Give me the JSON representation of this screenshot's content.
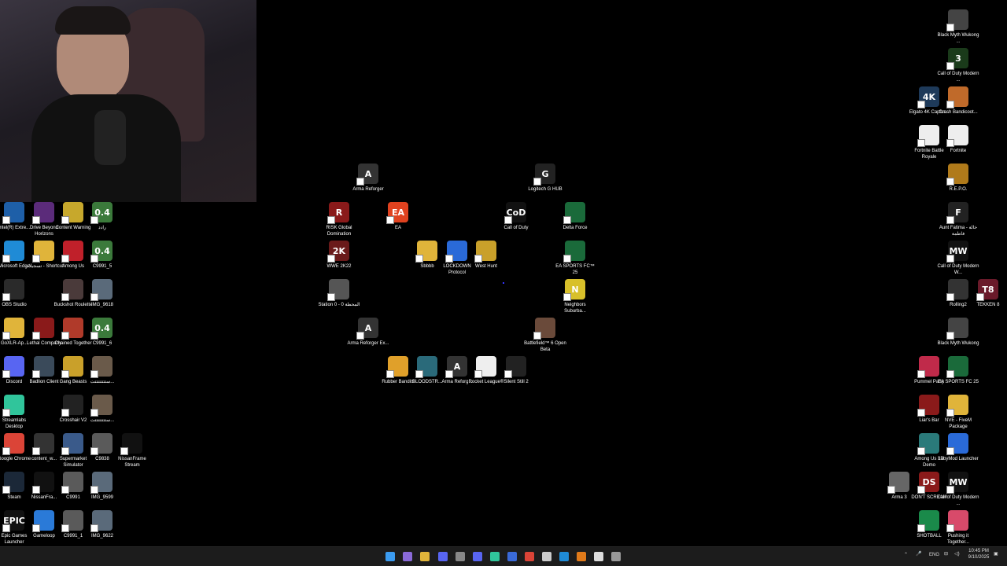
{
  "desktop_icons": [
    {
      "label": "Intel(R) Extre...",
      "color": "#1e5fa8",
      "glyph": ""
    },
    {
      "label": "Drive Beyond Horizons",
      "color": "#5b2b7a",
      "glyph": ""
    },
    {
      "label": "Content Warning",
      "color": "#c7a82c",
      "glyph": ""
    },
    {
      "label": "رادد",
      "color": "#3b7a3b",
      "glyph": "0.4"
    },
    {
      "label": "Microsoft Edge",
      "color": "#1f8bd6",
      "glyph": ""
    },
    {
      "label": "تسجيلات - Shortcut",
      "color": "#e0b43a",
      "glyph": ""
    },
    {
      "label": "Among Us",
      "color": "#c0202a",
      "glyph": ""
    },
    {
      "label": "C9991_5",
      "color": "#3b7a3b",
      "glyph": "0.4"
    },
    {
      "label": "OBS Studio",
      "color": "#2a2a2a",
      "glyph": ""
    },
    {
      "label": "Buckshot Roulette",
      "color": "#4a3a3a",
      "glyph": ""
    },
    {
      "label": "IMG_9618",
      "color": "#5a6a7a",
      "glyph": ""
    },
    {
      "label": "GoXLR-Ap...",
      "color": "#e0b43a",
      "glyph": ""
    },
    {
      "label": "Lethal Company",
      "color": "#8a1a1a",
      "glyph": ""
    },
    {
      "label": "Chained Together",
      "color": "#b03a2a",
      "glyph": ""
    },
    {
      "label": "C9991_6",
      "color": "#3b7a3b",
      "glyph": "0.4"
    },
    {
      "label": "Discord",
      "color": "#5865f2",
      "glyph": ""
    },
    {
      "label": "Badlion Client",
      "color": "#3a4a5a",
      "glyph": ""
    },
    {
      "label": "Gang Beasts",
      "color": "#c9a02a",
      "glyph": ""
    },
    {
      "label": "ستتتتتتتتت...",
      "color": "#6a5a4a",
      "glyph": ""
    },
    {
      "label": "Streamlabs Desktop",
      "color": "#30c59b",
      "glyph": ""
    },
    {
      "label": "Crosshair V2",
      "color": "#222",
      "glyph": ""
    },
    {
      "label": "ستتتتتتتتت...",
      "color": "#6a5a4a",
      "glyph": ""
    },
    {
      "label": "Google Chrome",
      "color": "#db4437",
      "glyph": ""
    },
    {
      "label": "content_w...",
      "color": "#333",
      "glyph": ""
    },
    {
      "label": "Supermarket Simulator",
      "color": "#3a5a8a",
      "glyph": ""
    },
    {
      "label": "C9838",
      "color": "#5a5a5a",
      "glyph": ""
    },
    {
      "label": "NissanFrame Stream",
      "color": "#111",
      "glyph": ""
    },
    {
      "label": "Steam",
      "color": "#1b2838",
      "glyph": ""
    },
    {
      "label": "NissanFra...",
      "color": "#111",
      "glyph": ""
    },
    {
      "label": "C9991",
      "color": "#5a5a5a",
      "glyph": ""
    },
    {
      "label": "IMG_9599",
      "color": "#5a6a7a",
      "glyph": ""
    },
    {
      "label": "Epic Games Launcher",
      "color": "#111",
      "glyph": "EPIC"
    },
    {
      "label": "Gameloop",
      "color": "#2a7ad8",
      "glyph": ""
    },
    {
      "label": "C9991_1",
      "color": "#5a5a5a",
      "glyph": ""
    },
    {
      "label": "IMG_9622",
      "color": "#5a6a7a",
      "glyph": ""
    },
    {
      "label": "Arma Reforger",
      "color": "#333",
      "glyph": "A"
    },
    {
      "label": "Logitech G HUB",
      "color": "#222",
      "glyph": "G"
    },
    {
      "label": "RISK Global Domination",
      "color": "#8a1a1a",
      "glyph": "R"
    },
    {
      "label": "EA",
      "color": "#e0421f",
      "glyph": "EA"
    },
    {
      "label": "Call of Duty",
      "color": "#111",
      "glyph": "CoD"
    },
    {
      "label": "Delta Force",
      "color": "#1a6a3a",
      "glyph": ""
    },
    {
      "label": "WWE 2K22",
      "color": "#6a1a1a",
      "glyph": "2K"
    },
    {
      "label": "Sbbbb",
      "color": "#e0b43a",
      "glyph": ""
    },
    {
      "label": "LOCKDOWN Protocol",
      "color": "#2a6ad8",
      "glyph": ""
    },
    {
      "label": "West Hunt",
      "color": "#c9a02a",
      "glyph": ""
    },
    {
      "label": "EA SPORTS FC™ 25",
      "color": "#1a6a3a",
      "glyph": ""
    },
    {
      "label": "Station 0 - المحطة 0",
      "color": "#555",
      "glyph": ""
    },
    {
      "label": "Neighbors Suburba...",
      "color": "#d8c02a",
      "glyph": "N"
    },
    {
      "label": "Arma Reforger Ex...",
      "color": "#333",
      "glyph": "A"
    },
    {
      "label": "Battlefield™ 6 Open Beta",
      "color": "#6a4a3a",
      "glyph": ""
    },
    {
      "label": "Rubber Bandits",
      "color": "#e0a02a",
      "glyph": ""
    },
    {
      "label": "BLOODSTR...",
      "color": "#2a6a7a",
      "glyph": ""
    },
    {
      "label": "Arma Reforg...",
      "color": "#333",
      "glyph": "A"
    },
    {
      "label": "Rocket League®",
      "color": "#eee",
      "glyph": ""
    },
    {
      "label": "Silent Still 2",
      "color": "#222",
      "glyph": ""
    },
    {
      "label": "Black Myth Wukong ...",
      "color": "#444",
      "glyph": ""
    },
    {
      "label": "Call of Duty Modern ...",
      "color": "#1a3a1a",
      "glyph": "3"
    },
    {
      "label": "Elgato 4K Captur...",
      "color": "#1e3a5a",
      "glyph": "4K"
    },
    {
      "label": "Crash Bandicoot...",
      "color": "#c06a2a",
      "glyph": ""
    },
    {
      "label": "Fortnite Battle Royale",
      "color": "#eee",
      "glyph": ""
    },
    {
      "label": "Fortnite",
      "color": "#eee",
      "glyph": ""
    },
    {
      "label": "R.E.P.O.",
      "color": "#b07a1a",
      "glyph": ""
    },
    {
      "label": "Aunt Fatima - خالة فاطمة",
      "color": "#222",
      "glyph": "F"
    },
    {
      "label": "Call of Duty Modern W...",
      "color": "#111",
      "glyph": "MW"
    },
    {
      "label": "Rolling2",
      "color": "#333",
      "glyph": ""
    },
    {
      "label": "TEKKEN 8",
      "color": "#6a1a2a",
      "glyph": "T8"
    },
    {
      "label": "Black Myth Wukong",
      "color": "#444",
      "glyph": ""
    },
    {
      "label": "Pummel Party",
      "color": "#c02a4a",
      "glyph": ""
    },
    {
      "label": "EA SPORTS FC 25",
      "color": "#1a6a3a",
      "glyph": ""
    },
    {
      "label": "Liar's Bar",
      "color": "#8a1a1a",
      "glyph": ""
    },
    {
      "label": "NVE - FiveM Package",
      "color": "#e0b43a",
      "glyph": ""
    },
    {
      "label": "Among Us 3D Demo",
      "color": "#2a7a7a",
      "glyph": ""
    },
    {
      "label": "LabyMod Launcher",
      "color": "#2a6ad8",
      "glyph": ""
    },
    {
      "label": "Arma 3",
      "color": "#666",
      "glyph": ""
    },
    {
      "label": "DON'T SCREAM",
      "color": "#8a1a1a",
      "glyph": "DS"
    },
    {
      "label": "Call of Duty Modern ...",
      "color": "#111",
      "glyph": "MW"
    },
    {
      "label": "SHOTBALL",
      "color": "#1a8a4a",
      "glyph": ""
    },
    {
      "label": "Pushing it Together...",
      "color": "#d84a6a",
      "glyph": ""
    }
  ],
  "taskbar": {
    "apps": [
      {
        "name": "windows-start-icon",
        "color": "#3b9bf0"
      },
      {
        "name": "copilot-icon",
        "color": "#8a6ad8"
      },
      {
        "name": "file-explorer-icon",
        "color": "#e0b43a"
      },
      {
        "name": "discord-icon",
        "color": "#5865f2"
      },
      {
        "name": "xbox-icon",
        "color": "#888"
      },
      {
        "name": "discord-app-icon",
        "color": "#5865f2"
      },
      {
        "name": "streamlabs-icon",
        "color": "#30c59b"
      },
      {
        "name": "steam-icon",
        "color": "#3a6ad8"
      },
      {
        "name": "chrome-icon",
        "color": "#db4437"
      },
      {
        "name": "epic-games-icon",
        "color": "#ccc"
      },
      {
        "name": "edge-icon",
        "color": "#1f8bd6"
      },
      {
        "name": "avast-icon",
        "color": "#e07a1a"
      },
      {
        "name": "crosshair-icon",
        "color": "#ddd"
      },
      {
        "name": "settings-icon",
        "color": "#999"
      }
    ],
    "tray_lang": "ENG",
    "time": "10:45 PM",
    "date": "9/10/2025"
  }
}
